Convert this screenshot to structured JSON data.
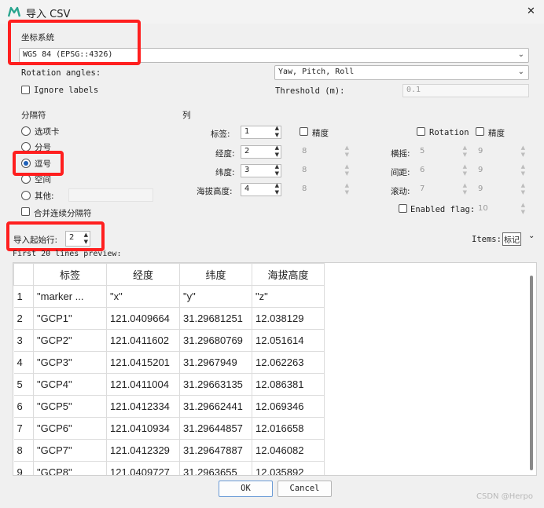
{
  "window": {
    "title": "导入 CSV",
    "close_glyph": "✕"
  },
  "crs": {
    "label": "坐标系统",
    "value": "WGS 84 (EPSG::4326)"
  },
  "rotation": {
    "label": "Rotation angles:",
    "value": "Yaw, Pitch, Roll"
  },
  "ignore_labels": {
    "label": "Ignore labels",
    "checked": false
  },
  "threshold": {
    "label": "Threshold (m):",
    "value": "0.1"
  },
  "delimiter": {
    "label": "分隔符",
    "options": [
      {
        "label": "选项卡",
        "selected": false
      },
      {
        "label": "分号",
        "selected": false
      },
      {
        "label": "逗号",
        "selected": true
      },
      {
        "label": "空间",
        "selected": false
      },
      {
        "label": "其他:",
        "selected": false
      }
    ],
    "merge_label": "合并连续分隔符"
  },
  "columns": {
    "label": "列",
    "fields": [
      {
        "label": "标签:",
        "value": "1"
      },
      {
        "label": "经度:",
        "value": "2"
      },
      {
        "label": "纬度:",
        "value": "3"
      },
      {
        "label": "海拔高度:",
        "value": "4"
      }
    ],
    "accuracy_label": "精度",
    "accuracy_values": [
      "8",
      "8",
      "8"
    ],
    "rotation_label": "Rotation",
    "rot_fields": [
      {
        "label": "横摇:",
        "value": "5",
        "acc": "9"
      },
      {
        "label": "间距:",
        "value": "6",
        "acc": "9"
      },
      {
        "label": "滚动:",
        "value": "7",
        "acc": "9"
      }
    ],
    "enabled_flag": {
      "label": "Enabled flag:",
      "value": "10"
    }
  },
  "start_row": {
    "label": "导入起始行:",
    "value": "2"
  },
  "items": {
    "label": "Items:",
    "value": "标记"
  },
  "preview": {
    "label": "First 20 lines preview:",
    "headers": [
      "标签",
      "经度",
      "纬度",
      "海拔高度"
    ],
    "rows": [
      {
        "n": "1",
        "c": [
          "\"marker ...",
          "\"x\"",
          "\"y\"",
          "\"z\""
        ]
      },
      {
        "n": "2",
        "c": [
          "\"GCP1\"",
          "121.0409664",
          "31.29681251",
          "12.038129"
        ]
      },
      {
        "n": "3",
        "c": [
          "\"GCP2\"",
          "121.0411602",
          "31.29680769",
          "12.051614"
        ]
      },
      {
        "n": "4",
        "c": [
          "\"GCP3\"",
          "121.0415201",
          "31.2967949",
          "12.062263"
        ]
      },
      {
        "n": "5",
        "c": [
          "\"GCP4\"",
          "121.0411004",
          "31.29663135",
          "12.086381"
        ]
      },
      {
        "n": "6",
        "c": [
          "\"GCP5\"",
          "121.0412334",
          "31.29662441",
          "12.069346"
        ]
      },
      {
        "n": "7",
        "c": [
          "\"GCP6\"",
          "121.0410934",
          "31.29644857",
          "12.016658"
        ]
      },
      {
        "n": "8",
        "c": [
          "\"GCP7\"",
          "121.0412329",
          "31.29647887",
          "12.046082"
        ]
      },
      {
        "n": "9",
        "c": [
          "\"GCP8\"",
          "121.0409727",
          "31.2963655",
          "12.035892"
        ]
      }
    ]
  },
  "buttons": {
    "ok": "OK",
    "cancel": "Cancel"
  },
  "watermark": "CSDN @Herpo"
}
